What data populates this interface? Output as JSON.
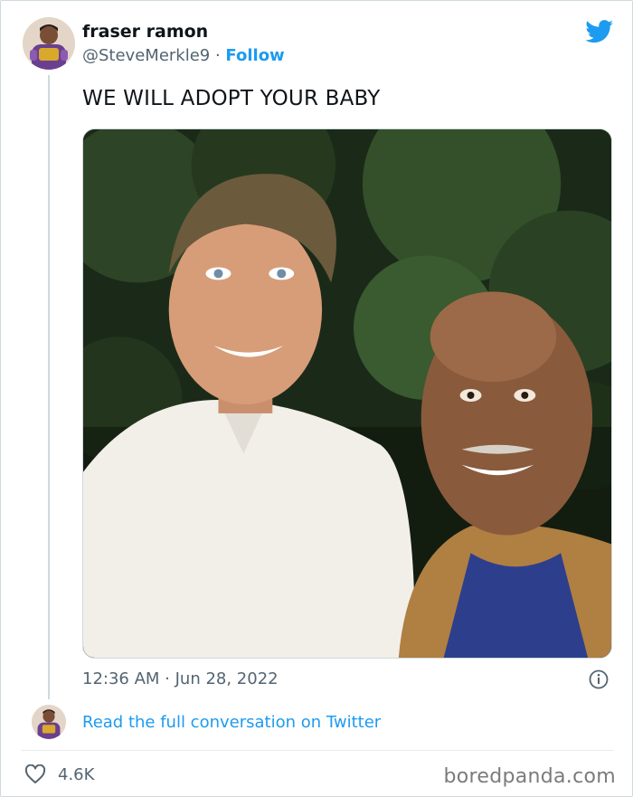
{
  "tweet": {
    "author_name": "fraser ramon",
    "author_handle": "@SteveMerkle9",
    "separator": " · ",
    "follow_label": "Follow",
    "text": "WE WILL ADOPT YOUR BABY",
    "timestamp": "12:36 AM · Jun 28, 2022",
    "read_link": "Read the full conversation on Twitter",
    "like_count": "4.6K"
  },
  "watermark": "boredpanda.com",
  "icons": {
    "brand": "twitter-bird-icon",
    "info": "info-icon",
    "like": "heart-icon"
  },
  "colors": {
    "link": "#1d9bf0",
    "secondary_text": "#536471",
    "primary_text": "#0f1419",
    "border": "#cfd9de"
  }
}
